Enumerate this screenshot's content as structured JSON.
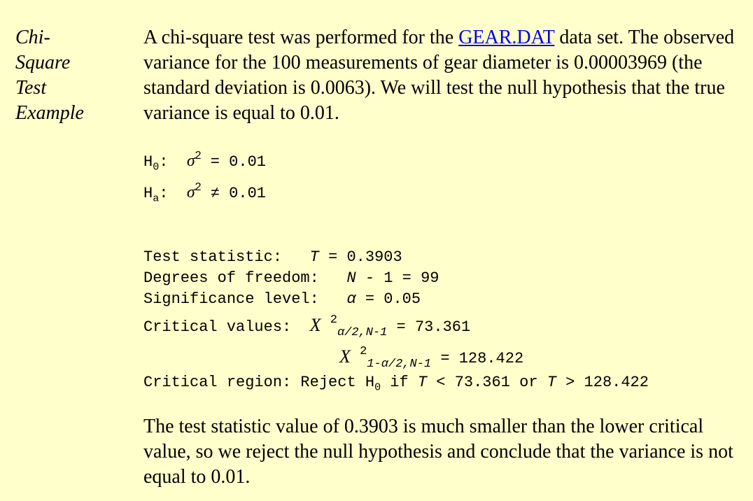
{
  "sidebar": {
    "heading_lines": [
      "Chi-",
      "Square",
      "Test",
      "Example"
    ]
  },
  "intro": {
    "before_link": "A chi-square test was performed for the ",
    "link_text": "GEAR.DAT",
    "after_link": " data set. The observed variance for the 100 measurements of gear diameter is 0.00003969 (the standard deviation is 0.0063). We will test the null hypothesis that the true variance is equal to 0.01."
  },
  "hypotheses": {
    "h0_label": "H",
    "h0_sub": "0",
    "h0_sigma": "σ",
    "h0_exp": "2",
    "h0_rel": " = 0.01",
    "ha_label": "H",
    "ha_sub": "a",
    "ha_sigma": "σ",
    "ha_exp": "2",
    "ha_rel": " ≠ 0.01"
  },
  "results": {
    "test_statistic_label": "Test statistic:   ",
    "test_statistic_sym": "T",
    "test_statistic_value": " = 0.3903",
    "dof_label": "Degrees of freedom:   ",
    "dof_sym": "N",
    "dof_value": " - 1 = 99",
    "significance_label": "Significance level:   ",
    "significance_sym": "α",
    "significance_value": " = 0.05",
    "critical_label": "Critical values:  ",
    "chi_sym": "X",
    "chi_exp": "2",
    "crit_lower_sub": "α/2,N-1",
    "crit_lower_value": " = 73.361",
    "crit_upper_sub": "1-α/2,N-1",
    "crit_upper_value": " = 128.422",
    "region_label": "Critical region: Reject H",
    "region_sub": "0",
    "region_if": " if ",
    "region_sym1": "T",
    "region_mid": " < 73.361 or ",
    "region_sym2": "T",
    "region_end": " > 128.422"
  },
  "conclusion": {
    "text": "The test statistic value of 0.3903 is much smaller than the lower critical value, so we reject the null hypothesis and conclude that the variance is not equal to 0.01."
  }
}
